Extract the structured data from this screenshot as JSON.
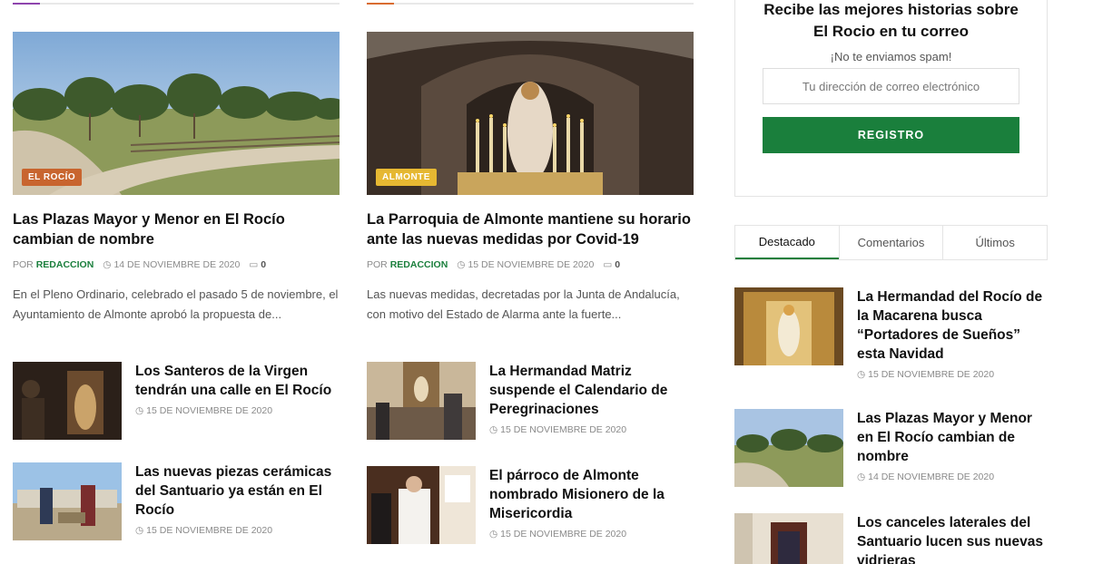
{
  "colors": {
    "accent_green": "#1a7f3c",
    "cat_el_rocio": "#c8652f",
    "cat_almonte": "#e6b832",
    "accent_purple": "#8e44ad",
    "accent_orange": "#d96c31"
  },
  "featured": [
    {
      "category": "EL ROCÍO",
      "title": "Las Plazas Mayor y Menor en El Rocío cambian de nombre",
      "author_prefix": "POR",
      "author": "REDACCION",
      "date": "14 DE NOVIEMBRE DE 2020",
      "comments": "0",
      "excerpt": "En el Pleno Ordinario, celebrado el pasado 5 de noviembre, el Ayuntamiento de Almonte aprobó la propuesta de..."
    },
    {
      "category": "ALMONTE",
      "title": "La Parroquia de Almonte mantiene su horario ante las nuevas medidas por Covid-19",
      "author_prefix": "POR",
      "author": "REDACCION",
      "date": "15 DE NOVIEMBRE DE 2020",
      "comments": "0",
      "excerpt": "Las nuevas medidas, decretadas por la Junta de Andalucía, con motivo del Estado de Alarma ante la fuerte..."
    }
  ],
  "small_left": [
    {
      "title": "Los Santeros de la Virgen tendrán una calle en El Rocío",
      "date": "15 DE NOVIEMBRE DE 2020"
    },
    {
      "title": "Las nuevas piezas cerámicas del Santuario ya están en El Rocío",
      "date": "15 DE NOVIEMBRE DE 2020"
    }
  ],
  "small_right": [
    {
      "title": "La Hermandad Matriz suspende el Calendario de Peregrinaciones",
      "date": "15 DE NOVIEMBRE DE 2020"
    },
    {
      "title": "El párroco de Almonte nombrado Misionero de la Misericordia",
      "date": "15 DE NOVIEMBRE DE 2020"
    }
  ],
  "newsletter": {
    "title": "Recibe las mejores historias sobre El Rocio en tu correo",
    "note": "¡No te enviamos spam!",
    "placeholder": "Tu dirección de correo electrónico",
    "button": "REGISTRO"
  },
  "tabs": [
    "Destacado",
    "Comentarios",
    "Últimos"
  ],
  "sidebar_posts": [
    {
      "title": "La Hermandad del Rocío de la Macarena busca “Portadores de Sueños” esta Navidad",
      "date": "15 DE NOVIEMBRE DE 2020"
    },
    {
      "title": "Las Plazas Mayor y Menor en El Rocío cambian de nombre",
      "date": "14 DE NOVIEMBRE DE 2020"
    },
    {
      "title": "Los canceles laterales del Santuario lucen sus nuevas vidrieras",
      "date": ""
    }
  ]
}
